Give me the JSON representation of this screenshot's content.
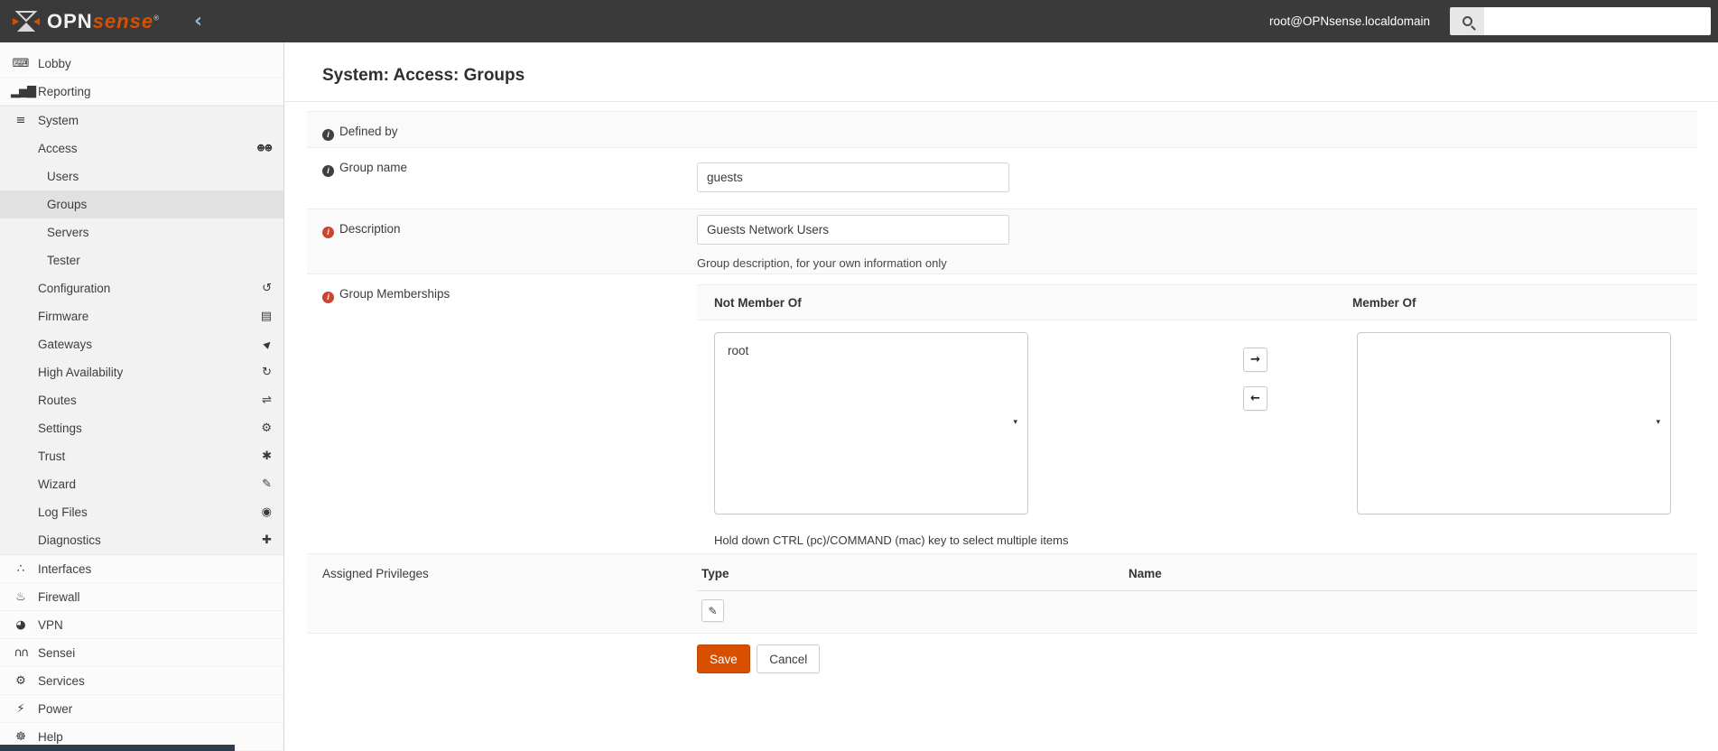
{
  "topbar": {
    "logo_opn": "OPN",
    "logo_sense": "sense",
    "logo_reg": "®",
    "collapse_glyph": "‹",
    "username": "root@OPNsense.localdomain",
    "search_placeholder": ""
  },
  "sidebar": {
    "items": [
      {
        "label": "Lobby",
        "glyph": "⌨"
      },
      {
        "label": "Reporting",
        "glyph": "▂▅▇"
      },
      {
        "label": "System",
        "glyph": "≡"
      },
      {
        "label": "Access",
        "right": "☻☻"
      },
      {
        "label": "Users"
      },
      {
        "label": "Groups"
      },
      {
        "label": "Servers"
      },
      {
        "label": "Tester"
      },
      {
        "label": "Configuration",
        "right": "↺"
      },
      {
        "label": "Firmware",
        "right": "▤"
      },
      {
        "label": "Gateways",
        "right": "▶"
      },
      {
        "label": "High Availability",
        "right": "↻"
      },
      {
        "label": "Routes",
        "right": "⇌"
      },
      {
        "label": "Settings",
        "right": "⚙"
      },
      {
        "label": "Trust",
        "right": "✱"
      },
      {
        "label": "Wizard",
        "right": "✎"
      },
      {
        "label": "Log Files",
        "right": "◉"
      },
      {
        "label": "Diagnostics",
        "right": "✚"
      },
      {
        "label": "Interfaces",
        "glyph": "∴"
      },
      {
        "label": "Firewall",
        "glyph": "♨"
      },
      {
        "label": "VPN",
        "glyph": "◕"
      },
      {
        "label": "Sensei",
        "glyph": "∩∩"
      },
      {
        "label": "Services",
        "glyph": "⚙"
      },
      {
        "label": "Power",
        "glyph": "⚡"
      },
      {
        "label": "Help",
        "glyph": "☸"
      }
    ]
  },
  "page": {
    "title": "System: Access: Groups"
  },
  "form": {
    "defined_by": {
      "label": "Defined by",
      "info_glyph": "i"
    },
    "group_name": {
      "label": "Group name",
      "info_glyph": "i",
      "value": "guests"
    },
    "description": {
      "label": "Description",
      "info_glyph": "i",
      "value": "Guests Network Users",
      "help": "Group description, for your own information only"
    },
    "memberships": {
      "label": "Group Memberships",
      "info_glyph": "i",
      "not_member_header": "Not Member Of",
      "member_header": "Member Of",
      "not_member_items": [
        "root"
      ],
      "member_items": [],
      "move_right_glyph": "→",
      "move_left_glyph": "←",
      "caret_glyph": "▾",
      "help": "Hold down CTRL (pc)/COMMAND (mac) key to select multiple items"
    },
    "privileges": {
      "label": "Assigned Privileges",
      "type_header": "Type",
      "name_header": "Name",
      "edit_glyph": "✎"
    },
    "actions": {
      "save": "Save",
      "cancel": "Cancel"
    }
  },
  "colors": {
    "accent": "#d94f00",
    "topbar_bg": "#3a3a3a",
    "required_icon": "#ca4532",
    "info_icon": "#3f3f3f"
  }
}
